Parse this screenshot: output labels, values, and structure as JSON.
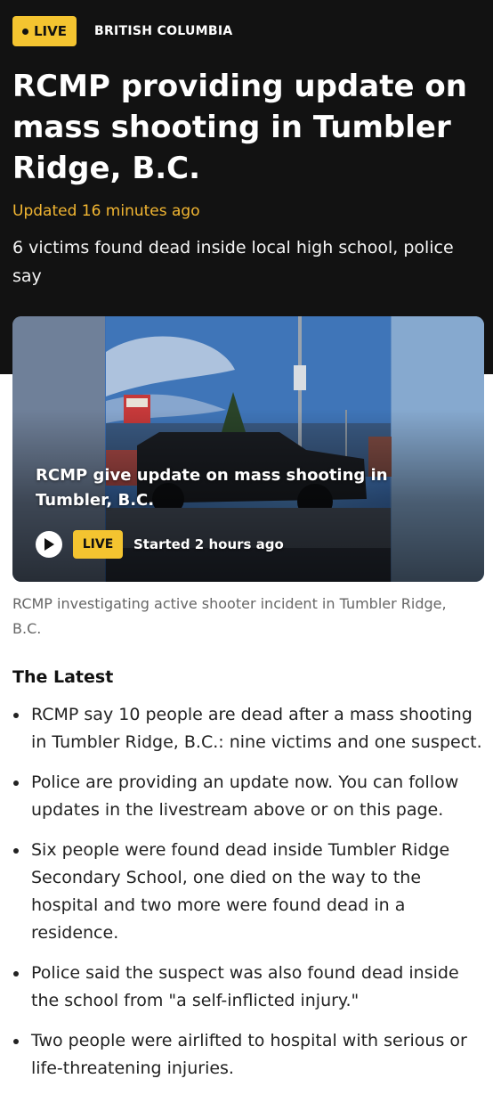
{
  "hero": {
    "live_badge": "LIVE",
    "section": "BRITISH COLUMBIA",
    "headline": "RCMP providing update on mass shooting in Tumbler Ridge, B.C.",
    "updated": "Updated 16 minutes ago",
    "dek": "6 victims found dead inside local high school, police say"
  },
  "video": {
    "title": "RCMP give update on mass shooting in Tumbler, B.C.",
    "live_badge": "LIVE",
    "started": "Started 2 hours ago",
    "caption": "RCMP investigating active shooter incident in Tumbler Ridge, B.C."
  },
  "latest": {
    "heading": "The Latest",
    "items": [
      "RCMP say 10 people are dead after a mass shooting in Tumbler Ridge, B.C.: nine victims and one suspect.",
      "Police are providing an update now. You can follow updates in the livestream above or on this page.",
      "Six people were found dead inside Tumbler Ridge Secondary School, one died on the way to the hospital and two more were found dead in a residence.",
      "Police said the suspect was also found dead inside the school from \"a self-inflicted injury.\"",
      "Two people were airlifted to hospital with serious or life-threatening injuries."
    ]
  },
  "colors": {
    "hero_background": "#121212",
    "accent_yellow": "#f4c430",
    "updated_text": "#f2b632"
  },
  "icons": {
    "play": "play-icon"
  }
}
